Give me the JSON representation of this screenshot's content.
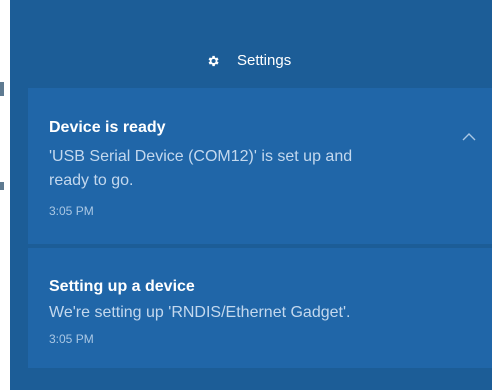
{
  "action_center": {
    "settings_label": "Settings",
    "settings_icon": "gear-icon",
    "notifications": [
      {
        "title": "Device is ready",
        "body_line1": "'USB Serial Device (COM12)' is set up and",
        "body_line2": "ready to go.",
        "time": "3:05 PM",
        "action_icon": "chevron-up-icon"
      },
      {
        "title": "Setting up a device",
        "body": "We're setting up 'RNDIS/Ethernet Gadget'.",
        "time": "3:05 PM"
      }
    ]
  },
  "colors": {
    "panel_background": "#1c5d97",
    "notification_background": "#2066a8",
    "title_text": "#ffffff",
    "body_text": "#c3d8ee",
    "time_text": "#a9c7e4"
  }
}
